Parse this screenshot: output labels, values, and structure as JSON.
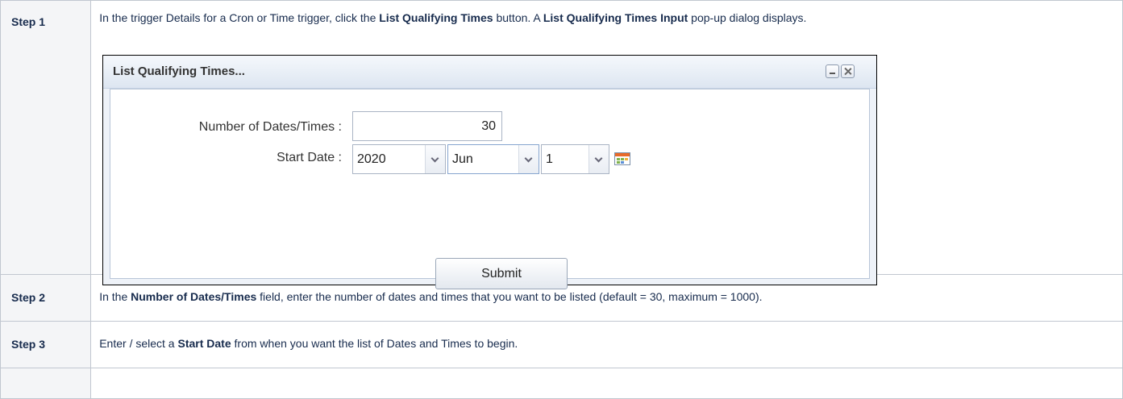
{
  "steps": [
    {
      "label": "Step 1",
      "parts": [
        {
          "text": "In the trigger Details for a Cron or Time trigger, click the ",
          "bold": false
        },
        {
          "text": "List Qualifying Times",
          "bold": true
        },
        {
          "text": " button. A ",
          "bold": false
        },
        {
          "text": "List Qualifying Times Input",
          "bold": true
        },
        {
          "text": " pop-up dialog displays.",
          "bold": false
        }
      ]
    },
    {
      "label": "Step 2",
      "parts": [
        {
          "text": "In the ",
          "bold": false
        },
        {
          "text": "Number of Dates/Times",
          "bold": true
        },
        {
          "text": " field, enter the number of dates and times that you want to be listed (default = 30, maximum = 1000).",
          "bold": false
        }
      ]
    },
    {
      "label": "Step 3",
      "parts": [
        {
          "text": "Enter / select a ",
          "bold": false
        },
        {
          "text": "Start Date",
          "bold": true
        },
        {
          "text": " from when you want the list of Dates and Times to begin.",
          "bold": false
        }
      ]
    },
    {
      "label": "",
      "parts": []
    }
  ],
  "dialog": {
    "title": "List Qualifying Times...",
    "number_label": "Number of Dates/Times :",
    "number_value": "30",
    "start_date_label": "Start Date :",
    "year": "2020",
    "month": "Jun",
    "day": "1",
    "submit_label": "Submit"
  }
}
